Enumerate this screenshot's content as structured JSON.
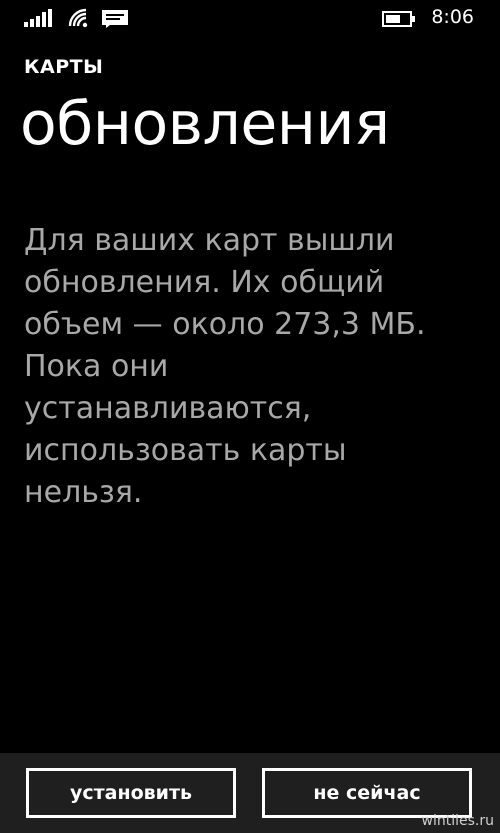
{
  "status_bar": {
    "time": "8:06",
    "icons": [
      "signal-icon",
      "wifi-icon",
      "message-icon",
      "battery-icon"
    ]
  },
  "header": {
    "app_name": "КАРТЫ",
    "page_title": "обновления"
  },
  "message": {
    "text": "Для ваших карт вышли обновления. Их общий объем — около 273,3 МБ. Пока они устанавливаются, использовать карты нельзя."
  },
  "app_bar": {
    "install_label": "установить",
    "later_label": "не сейчас"
  },
  "watermark": "wintiles.ru",
  "colors": {
    "background": "#000000",
    "foreground": "#ffffff",
    "body_text": "#a8a8a8",
    "app_bar": "#1f1f1f"
  }
}
